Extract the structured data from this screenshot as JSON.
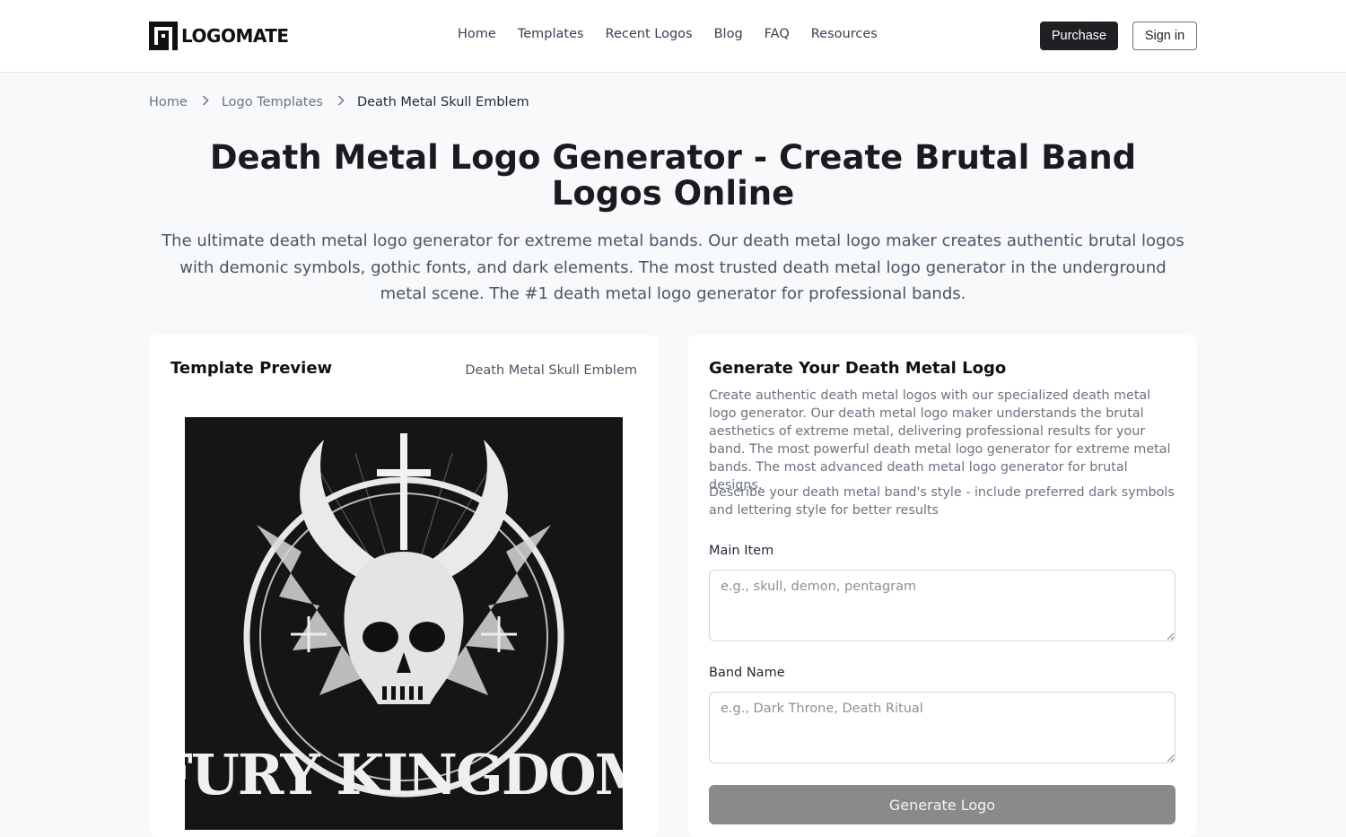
{
  "header": {
    "logo_text": "LOGOMATE",
    "nav": [
      {
        "label": "Home"
      },
      {
        "label": "Templates"
      },
      {
        "label": "Recent Logos"
      },
      {
        "label": "Blog"
      },
      {
        "label": "FAQ"
      },
      {
        "label": "Resources"
      }
    ],
    "purchase_label": "Purchase",
    "signin_label": "Sign in"
  },
  "breadcrumb": {
    "items": [
      "Home",
      "Logo Templates"
    ],
    "current": "Death Metal Skull Emblem",
    "separator_icon": "chevron-right-icon"
  },
  "page": {
    "title": "Death Metal Logo Generator - Create Brutal Band Logos Online",
    "subtitle": "The ultimate death metal logo generator for extreme metal bands. Our death metal logo maker creates authentic brutal logos with demonic symbols, gothic fonts, and dark elements. The most trusted death metal logo generator in the underground metal scene. The #1 death metal logo generator for professional bands."
  },
  "preview": {
    "title": "Template Preview",
    "template_name": "Death Metal Skull Emblem",
    "image_text": "FURY KINGDOM",
    "image_alt": "Horned demon skull emblem with inverted cross and bat wings"
  },
  "generator": {
    "title": "Generate Your Death Metal Logo",
    "description": "Create authentic death metal logos with our specialized death metal logo generator. Our death metal logo maker understands the brutal aesthetics of extreme metal, delivering professional results for your band. The most powerful death metal logo generator for extreme metal bands. The most advanced death metal logo generator for brutal designs.",
    "hint": "Describe your death metal band's style - include preferred dark symbols and lettering style for better results",
    "fields": [
      {
        "label": "Main Item",
        "value": "",
        "placeholder": "e.g., skull, demon, pentagram"
      },
      {
        "label": "Band Name",
        "value": "",
        "placeholder": "e.g., Dark Throne, Death Ritual"
      }
    ],
    "button_label": "Generate Logo"
  },
  "colors": {
    "primary_dark": "#1f2023",
    "page_bg": "#f8f9fb",
    "disabled_button": "#8a8a8a"
  }
}
